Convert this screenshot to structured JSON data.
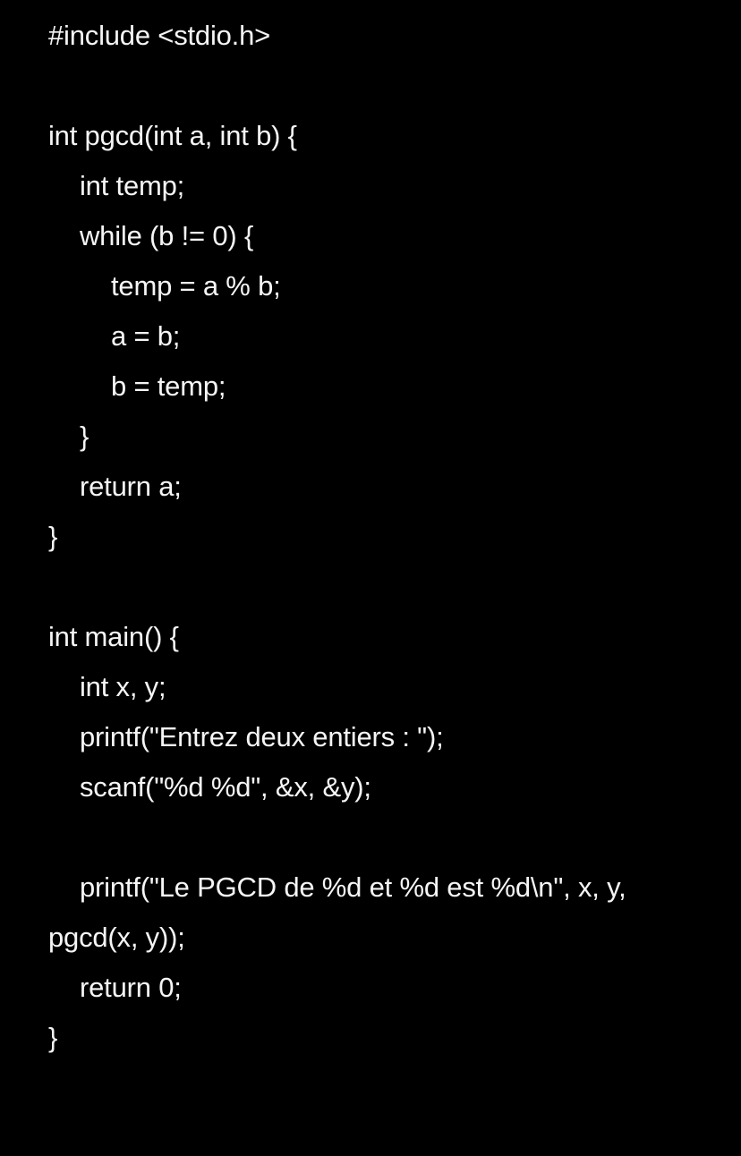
{
  "code": {
    "l01": "#include <stdio.h>",
    "l02": "int pgcd(int a, int b) {",
    "l03": "int temp;",
    "l04": "while (b != 0) {",
    "l05": "temp = a % b;",
    "l06": "a = b;",
    "l07": "b = temp;",
    "l08": "}",
    "l09": "return a;",
    "l10": "}",
    "l11": "int main() {",
    "l12": "int x, y;",
    "l13": "printf(\"Entrez deux entiers : \");",
    "l14": "scanf(\"%d %d\", &x, &y);",
    "l15": "printf(\"Le PGCD de %d et %d est %d\\n\", x, y,",
    "l16": "pgcd(x, y));",
    "l17": "return 0;",
    "l18": "}"
  },
  "colors": {
    "background": "#000000",
    "text": "#f5f5f5"
  }
}
